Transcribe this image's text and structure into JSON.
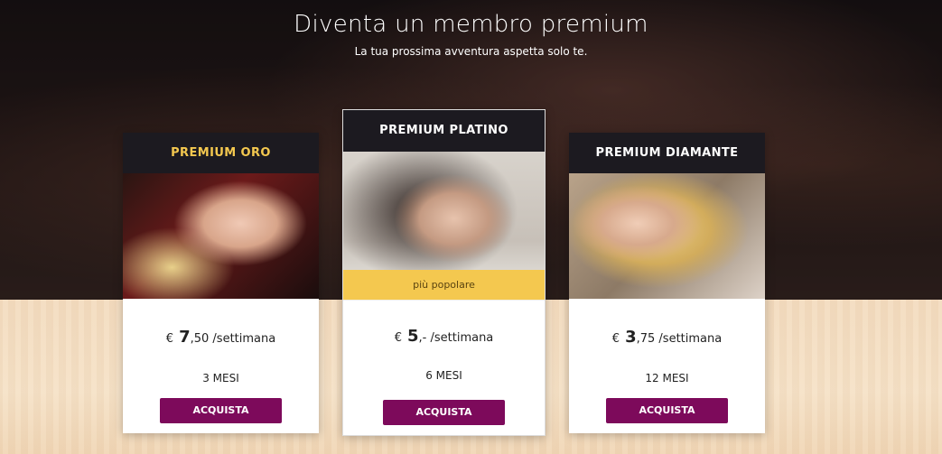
{
  "header": {
    "title": "Diventa un membro premium",
    "subtitle": "La tua prossima avventura aspetta solo te."
  },
  "plans": [
    {
      "name": "PREMIUM ORO",
      "name_color": "#f4c84f",
      "currency": "€",
      "price_main": "7",
      "price_rest": ",50",
      "period": "/settimana",
      "duration": "3 MESI",
      "button": "ACQUISTA"
    },
    {
      "name": "PREMIUM PLATINO",
      "name_color": "#ffffff",
      "badge": "più popolare",
      "currency": "€",
      "price_main": "5",
      "price_rest": ",-",
      "period": "/settimana",
      "duration": "6 MESI",
      "button": "ACQUISTA"
    },
    {
      "name": "PREMIUM DIAMANTE",
      "name_color": "#ffffff",
      "currency": "€",
      "price_main": "3",
      "price_rest": ",75",
      "period": "/settimana",
      "duration": "12 MESI",
      "button": "ACQUISTA"
    }
  ],
  "colors": {
    "button": "#7d0a5b",
    "badge": "#f4c84f",
    "card_header": "#1c1a20"
  }
}
